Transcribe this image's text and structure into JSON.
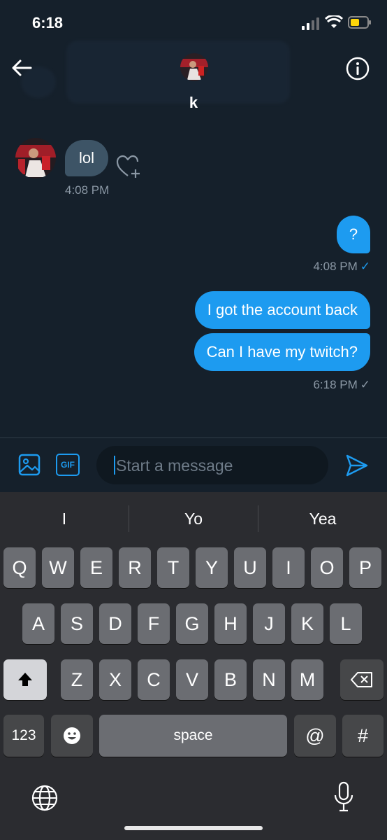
{
  "status_bar": {
    "time": "6:18"
  },
  "header": {
    "contact_name": "k",
    "back_icon": "arrow-left-icon",
    "info_icon": "info-icon"
  },
  "messages": {
    "incoming": [
      {
        "text": "lol",
        "time": "4:08 PM"
      }
    ],
    "outgoing": [
      {
        "text": "?",
        "time": "4:08 PM"
      },
      {
        "text": "I got the account back"
      },
      {
        "text": "Can I have my twitch?",
        "time": "6:18 PM"
      }
    ]
  },
  "composer": {
    "placeholder": "Start a message",
    "gif_label": "GIF"
  },
  "keyboard": {
    "suggestions": [
      "I",
      "Yo",
      "Yea"
    ],
    "row1": [
      "Q",
      "W",
      "E",
      "R",
      "T",
      "Y",
      "U",
      "I",
      "O",
      "P"
    ],
    "row2": [
      "A",
      "S",
      "D",
      "F",
      "G",
      "H",
      "J",
      "K",
      "L"
    ],
    "row3": [
      "Z",
      "X",
      "C",
      "V",
      "B",
      "N",
      "M"
    ],
    "numbers_label": "123",
    "space_label": "space",
    "at_label": "@",
    "hash_label": "#"
  },
  "colors": {
    "background": "#15202b",
    "accent": "#1d9bf0",
    "incoming_bubble": "#3d5466"
  }
}
